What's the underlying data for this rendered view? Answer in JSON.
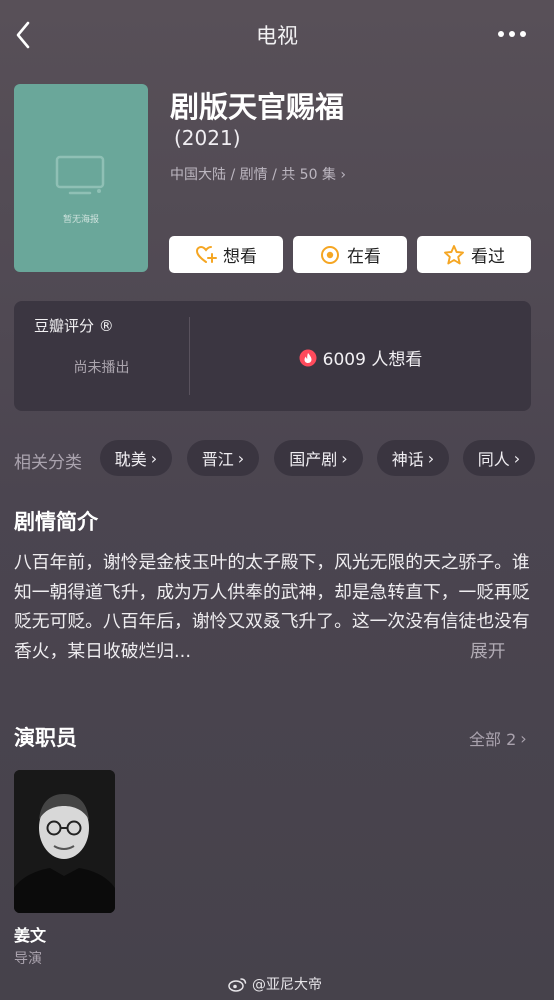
{
  "header": {
    "title": "电视",
    "back_icon": "back-chevron-icon",
    "more_icon": "more-dots-icon"
  },
  "show": {
    "poster_text": "暂无海报",
    "title": "剧版天官赐福",
    "year": "(2021)",
    "meta": "中国大陆 / 剧情 / 共 50 集",
    "actions": [
      {
        "label": "想看",
        "icon": "heart-plus-icon"
      },
      {
        "label": "在看",
        "icon": "watching-icon"
      },
      {
        "label": "看过",
        "icon": "star-icon"
      }
    ]
  },
  "rating": {
    "label": "豆瓣评分 ®",
    "status": "尚未播出",
    "want_count": "6009 人想看"
  },
  "categories": {
    "label": "相关分类",
    "items": [
      "耽美",
      "晋江",
      "国产剧",
      "神话",
      "同人"
    ]
  },
  "synopsis": {
    "heading": "剧情简介",
    "text": "八百年前，谢怜是金枝玉叶的太子殿下，风光无限的天之骄子。谁知一朝得道飞升，成为万人供奉的武神，却是急转直下，一贬再贬贬无可贬。八百年后，谢怜又双叒飞升了。这一次没有信徒也没有香火，某日收破烂归...",
    "expand": "展开"
  },
  "cast": {
    "heading": "演职员",
    "all_label": "全部 2",
    "members": [
      {
        "name": "姜文",
        "role": "导演"
      }
    ]
  },
  "watermark": "@亚尼大帝",
  "colors": {
    "background": "#4f4853",
    "poster": "#6aa79a",
    "accent_orange": "#f5a623",
    "card": "#3b3641"
  }
}
